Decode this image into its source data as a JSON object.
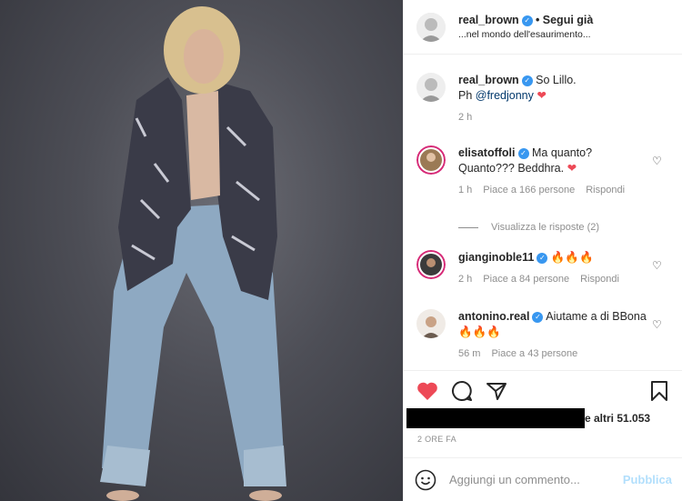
{
  "post": {
    "author": "real_brown",
    "follow_separator": "•",
    "follow_label": "Segui già",
    "subtitle": "...nel mondo dell'esaurimento..."
  },
  "caption": {
    "author": "real_brown",
    "text_line1": "So Lillo.",
    "text_line2_prefix": "Ph ",
    "mention": "@fredjonny",
    "heart": "❤",
    "time": "2 h"
  },
  "comments": [
    {
      "author": "elisatoffoli",
      "text": "Ma quanto? Quanto??? Beddhra.",
      "emoji": "❤",
      "time": "1 h",
      "likes": "Piace a 166 persone",
      "reply": "Rispondi"
    },
    {
      "author": "gianginoble11",
      "text": "",
      "emoji": "🔥🔥🔥",
      "time": "2 h",
      "likes": "Piace a 84 persone",
      "reply": "Rispondi"
    },
    {
      "author": "antonino.real",
      "text": "Aiutame a di BBona",
      "emoji": "🔥🔥🔥",
      "time": "56 m",
      "likes": "Piace a 43 persone",
      "reply": ""
    }
  ],
  "view_replies": "Visualizza le risposte (2)",
  "likes_text": "e altri 51.053",
  "timestamp": "2 ORE FA",
  "composer": {
    "placeholder": "Aggiungi un commento...",
    "publish": "Pubblica"
  },
  "colors": {
    "like_red": "#ed4956",
    "verified_blue": "#3897f0",
    "link_blue": "#00376b",
    "publish_disabled": "#b2dffc"
  }
}
